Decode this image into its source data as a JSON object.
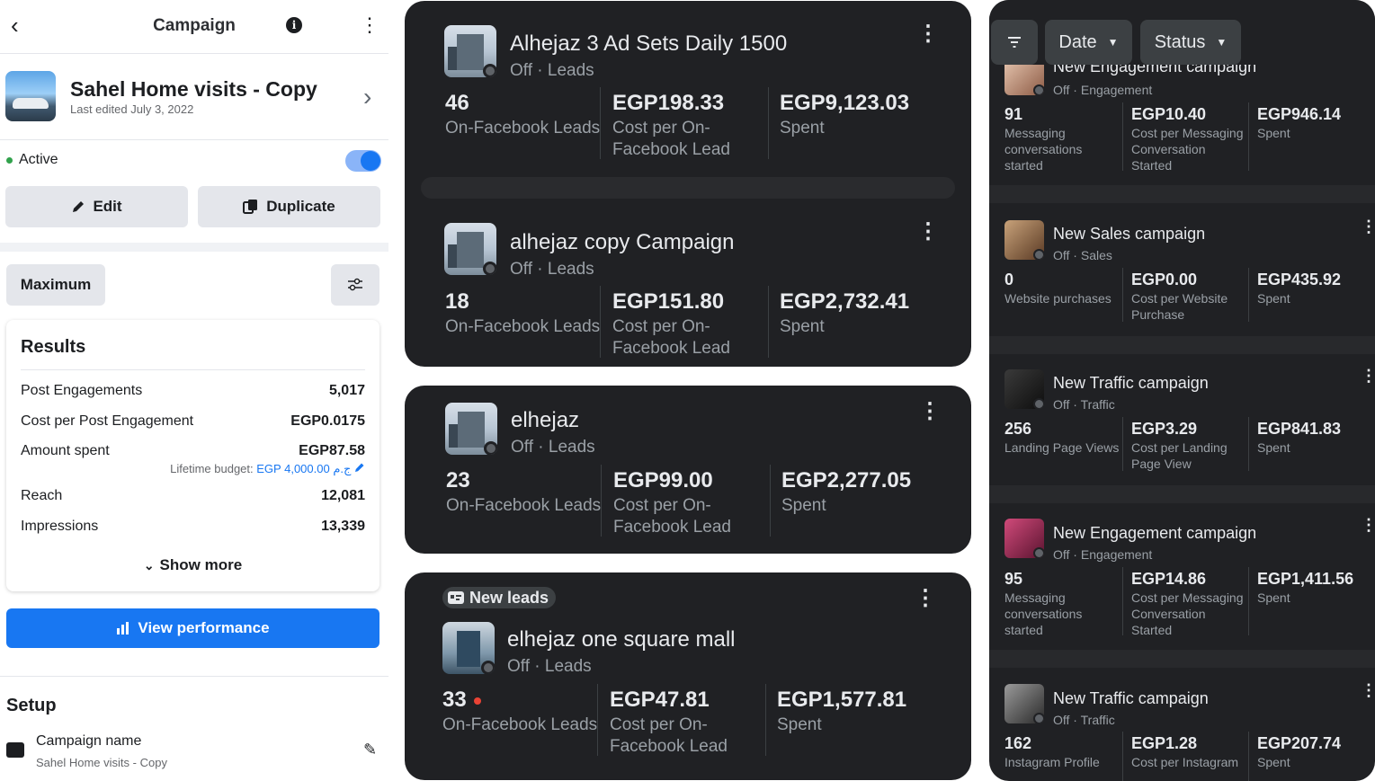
{
  "campaign_screen": {
    "title": "Campaign",
    "back_icon": "arrow-left-icon",
    "name": "Sahel Home visits - Copy",
    "last_edited": "Last edited July 3, 2022",
    "status_label": "Active",
    "toggle_on": true,
    "edit_label": "Edit",
    "duplicate_label": "Duplicate",
    "budget_strategy": "Maximum",
    "results": {
      "title": "Results",
      "rows": [
        {
          "label": "Post Engagements",
          "value": "5,017"
        },
        {
          "label": "Cost per Post Engagement",
          "value": "EGP0.0175"
        },
        {
          "label": "Amount spent",
          "value": "EGP87.58"
        },
        {
          "label": "Reach",
          "value": "12,081"
        },
        {
          "label": "Impressions",
          "value": "13,339"
        }
      ],
      "lifetime_budget_label": "Lifetime budget:",
      "lifetime_budget_value": "EGP 4,000.00 ج.م",
      "show_more": "Show more"
    },
    "view_performance": "View performance",
    "setup_title": "Setup",
    "campaign_name_label": "Campaign name",
    "campaign_name_value": "Sahel Home visits - Copy",
    "accent_color": "#1877f2"
  },
  "ad_cards": [
    {
      "name": "Alhejaz 3 Ad Sets Daily 1500",
      "status": "Off",
      "objective": "Leads",
      "metrics": [
        {
          "value": "46",
          "label1": "On-Facebook Leads",
          "label2": ""
        },
        {
          "value": "EGP198.33",
          "label1": "Cost per On-",
          "label2": "Facebook Lead"
        },
        {
          "value": "EGP9,123.03",
          "label1": "Spent",
          "label2": ""
        }
      ]
    },
    {
      "name": "alhejaz copy Campaign",
      "status": "Off",
      "objective": "Leads",
      "metrics": [
        {
          "value": "18",
          "label1": "On-Facebook Leads",
          "label2": ""
        },
        {
          "value": "EGP151.80",
          "label1": "Cost per On-",
          "label2": "Facebook Lead"
        },
        {
          "value": "EGP2,732.41",
          "label1": "Spent",
          "label2": ""
        }
      ]
    },
    {
      "name": "elhejaz",
      "status": "Off",
      "objective": "Leads",
      "metrics": [
        {
          "value": "23",
          "label1": "On-Facebook Leads",
          "label2": ""
        },
        {
          "value": "EGP99.00",
          "label1": "Cost per On-",
          "label2": "Facebook Lead"
        },
        {
          "value": "EGP2,277.05",
          "label1": "Spent",
          "label2": ""
        }
      ]
    },
    {
      "badge": "New leads",
      "name": "elhejaz one square mall",
      "status": "Off",
      "objective": "Leads",
      "metrics": [
        {
          "value": "33",
          "label1": "On-Facebook Leads",
          "label2": ""
        },
        {
          "value": "EGP47.81",
          "label1": "Cost per On-",
          "label2": "Facebook Lead"
        },
        {
          "value": "EGP1,577.81",
          "label1": "Spent",
          "label2": ""
        }
      ]
    }
  ],
  "campaign_list": {
    "filters": {
      "date": "Date",
      "status": "Status"
    },
    "items": [
      {
        "name": "New Engagement campaign",
        "status": "Off",
        "objective": "Engagement",
        "metrics": [
          {
            "value": "91",
            "lines": [
              "Messaging",
              "conversations",
              "started"
            ]
          },
          {
            "value": "EGP10.40",
            "lines": [
              "Cost per Messaging",
              "Conversation",
              "Started"
            ]
          },
          {
            "value": "EGP946.14",
            "lines": [
              "Spent"
            ]
          }
        ]
      },
      {
        "name": "New Sales campaign",
        "status": "Off",
        "objective": "Sales",
        "metrics": [
          {
            "value": "0",
            "lines": [
              "Website purchases"
            ]
          },
          {
            "value": "EGP0.00",
            "lines": [
              "Cost per Website",
              "Purchase"
            ]
          },
          {
            "value": "EGP435.92",
            "lines": [
              "Spent"
            ]
          }
        ]
      },
      {
        "name": "New Traffic campaign",
        "status": "Off",
        "objective": "Traffic",
        "metrics": [
          {
            "value": "256",
            "lines": [
              "Landing Page Views"
            ]
          },
          {
            "value": "EGP3.29",
            "lines": [
              "Cost per Landing",
              "Page View"
            ]
          },
          {
            "value": "EGP841.83",
            "lines": [
              "Spent"
            ]
          }
        ]
      },
      {
        "name": "New Engagement campaign",
        "status": "Off",
        "objective": "Engagement",
        "metrics": [
          {
            "value": "95",
            "lines": [
              "Messaging",
              "conversations",
              "started"
            ]
          },
          {
            "value": "EGP14.86",
            "lines": [
              "Cost per Messaging",
              "Conversation",
              "Started"
            ]
          },
          {
            "value": "EGP1,411.56",
            "lines": [
              "Spent"
            ]
          }
        ]
      },
      {
        "name": "New Traffic campaign",
        "status": "Off",
        "objective": "Traffic",
        "metrics": [
          {
            "value": "162",
            "lines": [
              "Instagram Profile"
            ]
          },
          {
            "value": "EGP1.28",
            "lines": [
              "Cost per Instagram"
            ]
          },
          {
            "value": "EGP207.74",
            "lines": [
              "Spent"
            ]
          }
        ]
      }
    ]
  }
}
